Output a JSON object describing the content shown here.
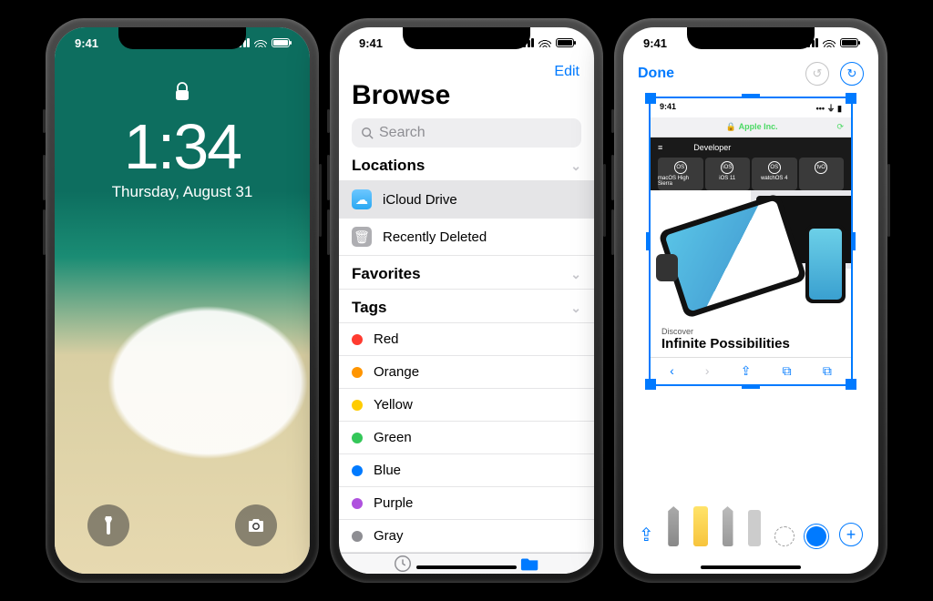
{
  "status_time": "9:41",
  "lock": {
    "time": "1:34",
    "date": "Thursday, August 31"
  },
  "files": {
    "edit": "Edit",
    "title": "Browse",
    "search_placeholder": "Search",
    "sections": {
      "locations": "Locations",
      "favorites": "Favorites",
      "tags": "Tags"
    },
    "locations": [
      {
        "label": "iCloud Drive"
      },
      {
        "label": "Recently Deleted"
      }
    ],
    "tags": [
      {
        "label": "Red",
        "color": "#ff3b30"
      },
      {
        "label": "Orange",
        "color": "#ff9500"
      },
      {
        "label": "Yellow",
        "color": "#ffcc00"
      },
      {
        "label": "Green",
        "color": "#34c759"
      },
      {
        "label": "Blue",
        "color": "#007aff"
      },
      {
        "label": "Purple",
        "color": "#af52de"
      },
      {
        "label": "Gray",
        "color": "#8e8e93"
      }
    ],
    "tabs": {
      "recents": "Recents",
      "browse": "Browse"
    }
  },
  "markup": {
    "done": "Done",
    "shot": {
      "status_time": "9:41",
      "url_host": "Apple Inc.",
      "dev_brand": "Developer",
      "os_items": [
        {
          "badge": "OS",
          "label": "macOS High Sierra"
        },
        {
          "badge": "iOS",
          "label": "iOS 11"
        },
        {
          "badge": "OS",
          "label": "watchOS 4"
        },
        {
          "badge": "tvO",
          "label": ""
        }
      ],
      "discover_kicker": "Discover",
      "discover_title": "Infinite Possibilities"
    }
  }
}
